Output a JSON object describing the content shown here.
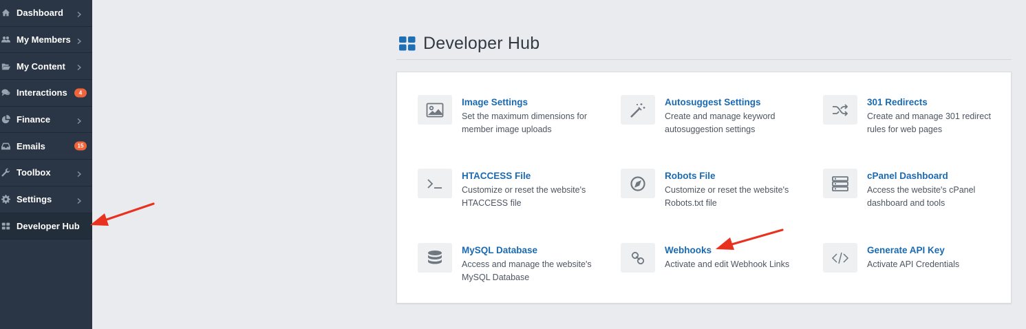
{
  "sidebar": {
    "items": [
      {
        "label": "Dashboard",
        "icon": "home-icon",
        "badge": null
      },
      {
        "label": "My Members",
        "icon": "users-icon",
        "badge": null
      },
      {
        "label": "My Content",
        "icon": "folder-open-icon",
        "badge": null
      },
      {
        "label": "Interactions",
        "icon": "comments-icon",
        "badge": "4"
      },
      {
        "label": "Finance",
        "icon": "pie-chart-icon",
        "badge": null
      },
      {
        "label": "Emails",
        "icon": "inbox-icon",
        "badge": "15"
      },
      {
        "label": "Toolbox",
        "icon": "wrench-icon",
        "badge": null
      },
      {
        "label": "Settings",
        "icon": "gear-icon",
        "badge": null
      },
      {
        "label": "Developer Hub",
        "icon": "grid-icon",
        "badge": null
      }
    ]
  },
  "header": {
    "title": "Developer Hub",
    "icon": "grid-icon",
    "accent_color": "#1f6fb5"
  },
  "tools": [
    {
      "title": "Image Settings",
      "desc": "Set the maximum dimensions for member image uploads",
      "icon": "image-icon"
    },
    {
      "title": "Autosuggest Settings",
      "desc": "Create and manage keyword autosuggestion settings",
      "icon": "magic-wand-icon"
    },
    {
      "title": "301 Redirects",
      "desc": "Create and manage 301 redirect rules for web pages",
      "icon": "shuffle-icon"
    },
    {
      "title": "HTACCESS File",
      "desc": "Customize or reset the website's HTACCESS file",
      "icon": "terminal-icon"
    },
    {
      "title": "Robots File",
      "desc": "Customize or reset the website's Robots.txt file",
      "icon": "compass-icon"
    },
    {
      "title": "cPanel Dashboard",
      "desc": "Access the website's cPanel dashboard and tools",
      "icon": "server-icon"
    },
    {
      "title": "MySQL Database",
      "desc": "Access and manage the website's MySQL Database",
      "icon": "database-icon"
    },
    {
      "title": "Webhooks",
      "desc": "Activate and edit Webhook Links",
      "icon": "link-icon"
    },
    {
      "title": "Generate API Key",
      "desc": "Activate API Credentials",
      "icon": "code-icon"
    }
  ],
  "colors": {
    "sidebar_bg": "#2a3645",
    "badge": "#f0643c",
    "link": "#1a6ab1",
    "annotation_arrow": "#e8321f"
  }
}
